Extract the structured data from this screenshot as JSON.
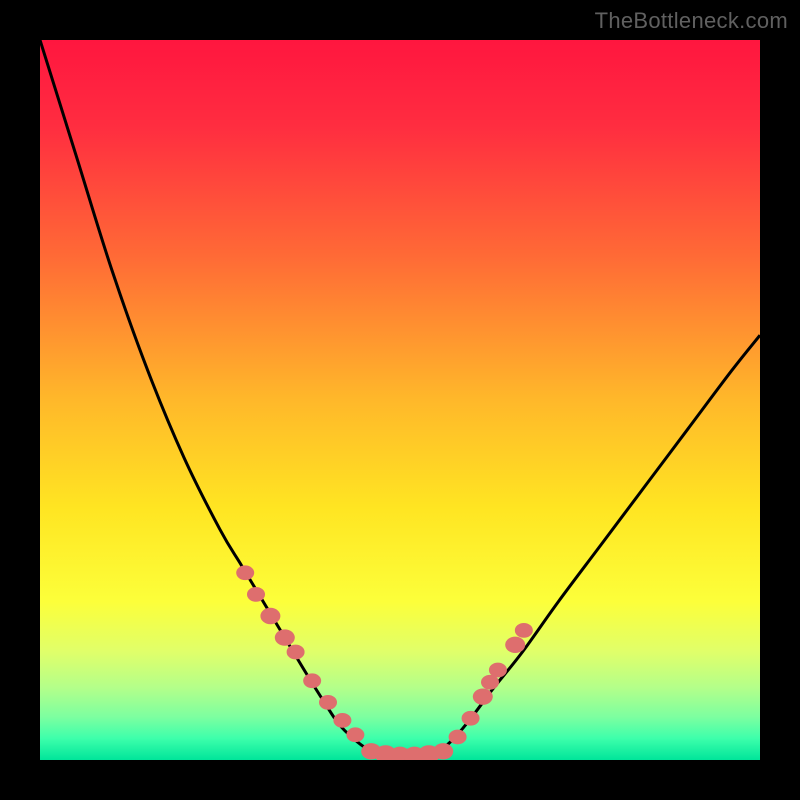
{
  "attribution": "TheBottleneck.com",
  "colors": {
    "gradient_stops": [
      {
        "offset": 0.0,
        "color": "#ff163f"
      },
      {
        "offset": 0.12,
        "color": "#ff2d40"
      },
      {
        "offset": 0.3,
        "color": "#ff6a36"
      },
      {
        "offset": 0.5,
        "color": "#ffb82a"
      },
      {
        "offset": 0.65,
        "color": "#ffe522"
      },
      {
        "offset": 0.78,
        "color": "#fcff3a"
      },
      {
        "offset": 0.85,
        "color": "#e0ff6a"
      },
      {
        "offset": 0.9,
        "color": "#b3ff8a"
      },
      {
        "offset": 0.94,
        "color": "#7dffa0"
      },
      {
        "offset": 0.97,
        "color": "#3dffab"
      },
      {
        "offset": 1.0,
        "color": "#00e59a"
      }
    ],
    "curve": "#000000",
    "marker_fill": "#de6e6e",
    "frame": "#000000"
  },
  "chart_data": {
    "type": "line",
    "title": "",
    "xlabel": "",
    "ylabel": "",
    "xlim": [
      0,
      1
    ],
    "ylim": [
      0,
      100
    ],
    "series": [
      {
        "name": "left-branch",
        "x": [
          0.0,
          0.05,
          0.1,
          0.15,
          0.2,
          0.25,
          0.28,
          0.31,
          0.34,
          0.37,
          0.395,
          0.415,
          0.435,
          0.455,
          0.475
        ],
        "y": [
          100,
          84,
          68,
          54,
          42,
          32,
          27,
          22,
          17,
          12,
          8,
          5,
          3,
          1.5,
          0.8
        ]
      },
      {
        "name": "flat-valley",
        "x": [
          0.475,
          0.5,
          0.525,
          0.55
        ],
        "y": [
          0.8,
          0.6,
          0.6,
          0.8
        ]
      },
      {
        "name": "right-branch",
        "x": [
          0.55,
          0.575,
          0.6,
          0.63,
          0.67,
          0.72,
          0.78,
          0.84,
          0.9,
          0.96,
          1.0
        ],
        "y": [
          0.8,
          3,
          6,
          10,
          15,
          22,
          30,
          38,
          46,
          54,
          59
        ]
      }
    ],
    "markers": {
      "name": "marker-points",
      "x": [
        0.285,
        0.3,
        0.32,
        0.34,
        0.355,
        0.378,
        0.4,
        0.42,
        0.438,
        0.46,
        0.48,
        0.5,
        0.52,
        0.54,
        0.56,
        0.58,
        0.598,
        0.615,
        0.625,
        0.636,
        0.66,
        0.672
      ],
      "y": [
        26,
        23,
        20,
        17,
        15,
        11,
        8,
        5.5,
        3.5,
        1.2,
        0.8,
        0.6,
        0.6,
        0.8,
        1.2,
        3.2,
        5.8,
        8.8,
        10.8,
        12.5,
        16,
        18
      ],
      "r": [
        9,
        9,
        10,
        10,
        9,
        9,
        9,
        9,
        9,
        10,
        11,
        11,
        11,
        11,
        10,
        9,
        9,
        10,
        9,
        9,
        10,
        9
      ]
    }
  }
}
